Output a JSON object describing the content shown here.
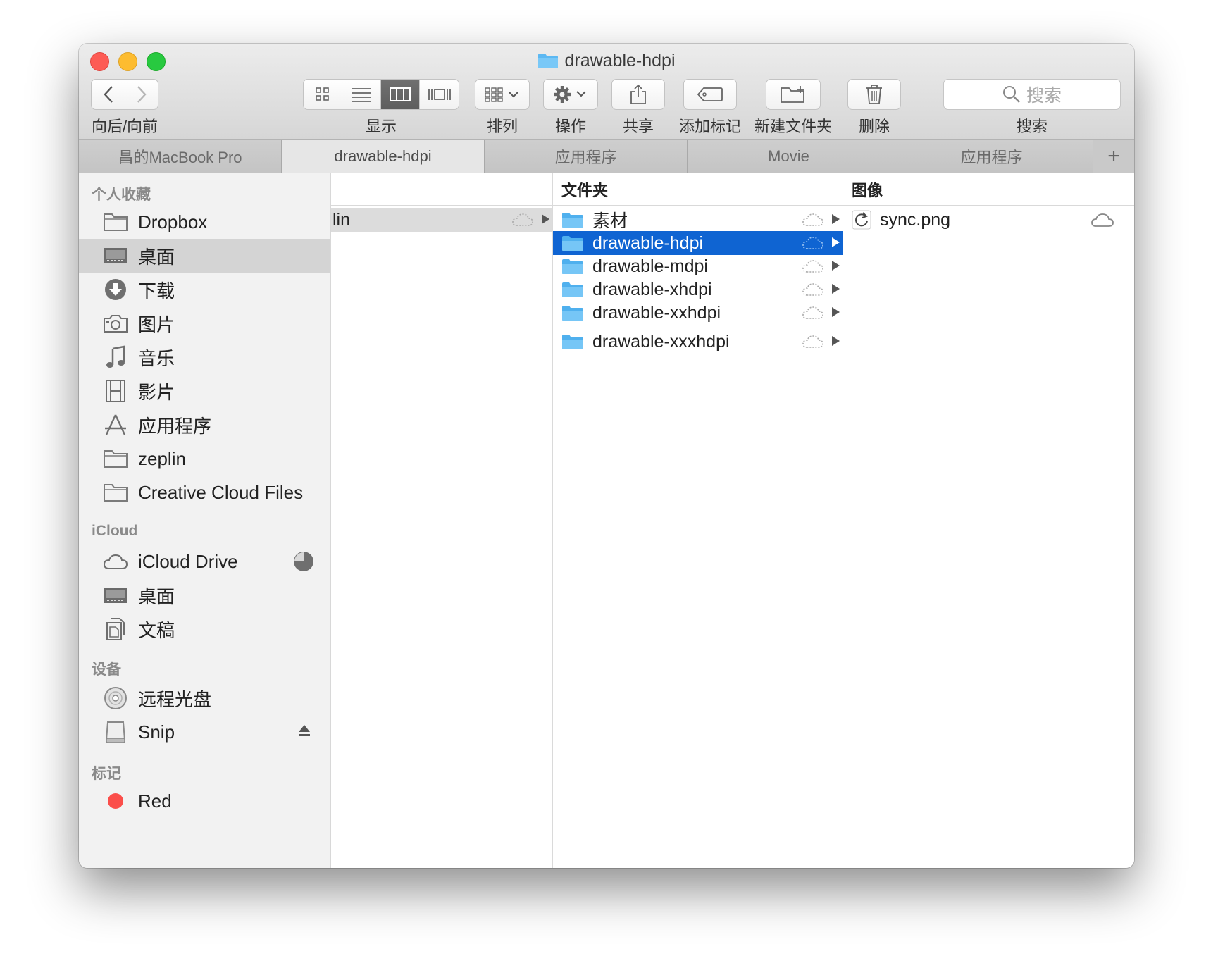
{
  "window": {
    "title": "drawable-hdpi"
  },
  "toolbar": {
    "nav_label": "向后/向前",
    "view_label": "显示",
    "arrange_label": "排列",
    "action_label": "操作",
    "share_label": "共享",
    "tag_label": "添加标记",
    "new_folder_label": "新建文件夹",
    "delete_label": "删除",
    "search_label": "搜索",
    "search_placeholder": "搜索",
    "active_view": "columns"
  },
  "tabs": [
    {
      "label": "昌的MacBook Pro",
      "active": false
    },
    {
      "label": "drawable-hdpi",
      "active": true
    },
    {
      "label": "应用程序",
      "active": false
    },
    {
      "label": "Movie",
      "active": false
    },
    {
      "label": "应用程序",
      "active": false
    }
  ],
  "tab_add": "+",
  "sidebar": {
    "favorites_header": "个人收藏",
    "favorites": [
      {
        "label": "Dropbox",
        "icon": "folder-icon"
      },
      {
        "label": "桌面",
        "icon": "desktop-icon",
        "selected": true
      },
      {
        "label": "下载",
        "icon": "download-icon"
      },
      {
        "label": "图片",
        "icon": "camera-icon"
      },
      {
        "label": "音乐",
        "icon": "music-note-icon"
      },
      {
        "label": "影片",
        "icon": "film-icon"
      },
      {
        "label": "应用程序",
        "icon": "applications-icon"
      },
      {
        "label": "zeplin",
        "icon": "folder-icon"
      },
      {
        "label": "Creative Cloud Files",
        "icon": "folder-icon"
      }
    ],
    "icloud_header": "iCloud",
    "icloud": [
      {
        "label": "iCloud Drive",
        "icon": "cloud-icon"
      },
      {
        "label": "桌面",
        "icon": "desktop-icon"
      },
      {
        "label": "文稿",
        "icon": "document-icon"
      }
    ],
    "devices_header": "设备",
    "devices": [
      {
        "label": "远程光盘",
        "icon": "disc-icon"
      },
      {
        "label": "Snip",
        "icon": "drive-icon"
      }
    ],
    "tags_header": "标记",
    "tags": [
      {
        "label": "Red",
        "color": "#fb4e4a"
      }
    ]
  },
  "columns": {
    "col1": {
      "header": "",
      "items": [
        {
          "name": "lin"
        }
      ]
    },
    "col2": {
      "header": "文件夹",
      "items": [
        {
          "name": "素材",
          "selected": false
        },
        {
          "name": "drawable-hdpi",
          "selected": true
        },
        {
          "name": "drawable-mdpi",
          "selected": false
        },
        {
          "name": "drawable-xhdpi",
          "selected": false
        },
        {
          "name": "drawable-xxhdpi",
          "selected": false
        },
        {
          "name": "drawable-xxxhdpi",
          "selected": false
        }
      ]
    },
    "col3": {
      "header": "图像",
      "items": [
        {
          "name": "sync.png"
        }
      ]
    }
  },
  "colors": {
    "selection": "#0f64d2",
    "folder": "#5cb8f2",
    "close": "#fd5b54",
    "minimize": "#fdbc30",
    "zoom": "#28c940"
  }
}
